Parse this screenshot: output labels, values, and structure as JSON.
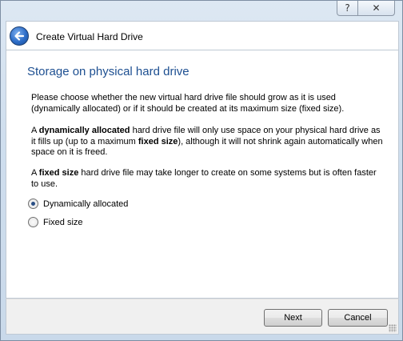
{
  "window": {
    "title": "Create Virtual Hard Drive",
    "help_glyph": "?",
    "close_glyph": "✕"
  },
  "page": {
    "heading": "Storage on physical hard drive",
    "intro": "Please choose whether the new virtual hard drive file should grow as it is used (dynamically allocated) or if it should be created at its maximum size (fixed size).",
    "dyn_prefix": "A ",
    "dyn_bold": "dynamically allocated",
    "dyn_middle": " hard drive file will only use space on your physical hard drive as it fills up (up to a maximum ",
    "dyn_bold2": "fixed size",
    "dyn_suffix": "), although it will not shrink again automatically when space on it is freed.",
    "fixed_prefix": "A ",
    "fixed_bold": "fixed size",
    "fixed_suffix": " hard drive file may take longer to create on some systems but is often faster to use."
  },
  "options": {
    "dynamic_label": "Dynamically allocated",
    "fixed_label": "Fixed size",
    "selected": "dynamic"
  },
  "buttons": {
    "next": "Next",
    "cancel": "Cancel"
  },
  "icons": {
    "back": "back-arrow-icon",
    "help": "help-icon",
    "close": "close-icon"
  },
  "colors": {
    "heading": "#1d4f91",
    "back_button": "#2c6cc7"
  }
}
